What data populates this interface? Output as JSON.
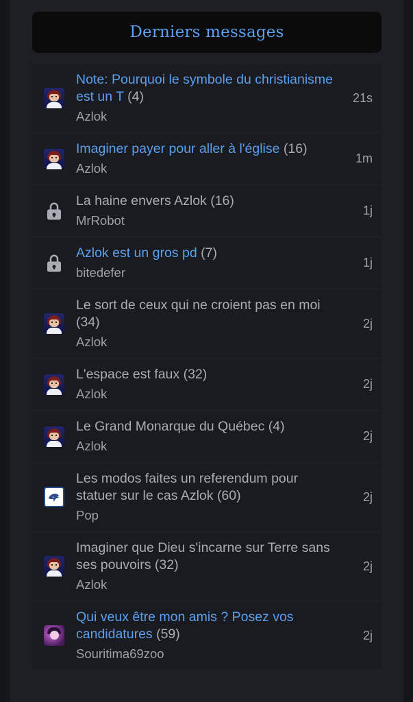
{
  "header": {
    "title": "Derniers messages"
  },
  "colors": {
    "accent": "#5aa0ee",
    "muted": "#a9acb3",
    "row_bg": "#1a1b20"
  },
  "topics": [
    {
      "title": "Note: Pourquoi le symbole du christianisme est un T",
      "count": "(4)",
      "author": "Azlok",
      "time": "21s",
      "unread": true,
      "avatar": "user-avatar-icon"
    },
    {
      "title": "Imaginer payer pour aller à l'église",
      "count": "(16)",
      "author": "Azlok",
      "time": "1m",
      "unread": true,
      "avatar": "user-avatar-icon"
    },
    {
      "title": "La haine envers Azlok",
      "count": "(16)",
      "author": "MrRobot",
      "time": "1j",
      "unread": false,
      "avatar": "lock-icon"
    },
    {
      "title": "Azlok est un gros pd",
      "count": "(7)",
      "author": "bitedefer",
      "time": "1j",
      "unread": true,
      "avatar": "lock-icon"
    },
    {
      "title": "Le sort de ceux qui ne croient pas en moi",
      "count": "(34)",
      "author": "Azlok",
      "time": "2j",
      "unread": false,
      "avatar": "user-avatar-icon"
    },
    {
      "title": "L'espace est faux",
      "count": "(32)",
      "author": "Azlok",
      "time": "2j",
      "unread": false,
      "avatar": "user-avatar-icon"
    },
    {
      "title": "Le Grand Monarque du Québec",
      "count": "(4)",
      "author": "Azlok",
      "time": "2j",
      "unread": false,
      "avatar": "user-avatar-icon"
    },
    {
      "title": "Les modos faites un referendum pour statuer sur le cas Azlok",
      "count": "(60)",
      "author": "Pop",
      "time": "2j",
      "unread": false,
      "avatar": "orca-avatar-icon"
    },
    {
      "title": "Imaginer que Dieu s'incarne sur Terre sans ses pouvoirs",
      "count": "(32)",
      "author": "Azlok",
      "time": "2j",
      "unread": false,
      "avatar": "user-avatar-icon"
    },
    {
      "title": "Qui veux être mon amis ? Posez vos candidatures",
      "count": "(59)",
      "author": "Souritima69zoo",
      "time": "2j",
      "unread": true,
      "avatar": "purple-avatar-icon"
    }
  ]
}
